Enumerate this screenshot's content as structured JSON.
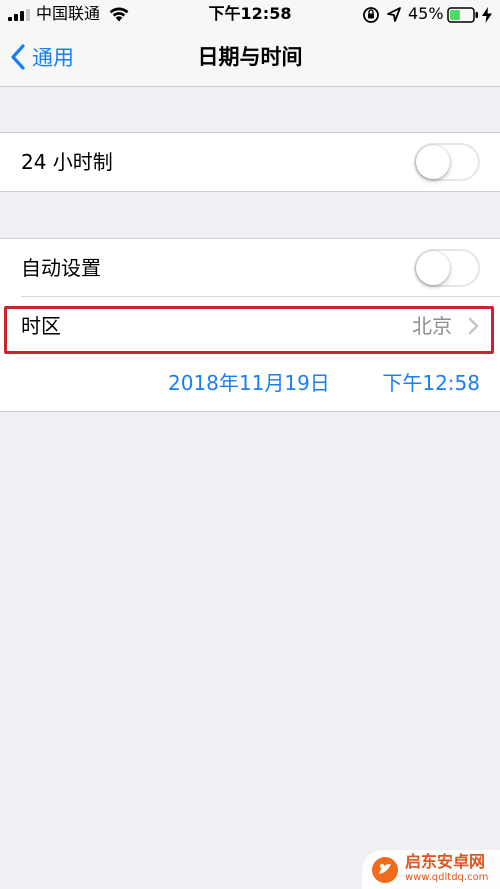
{
  "status_bar": {
    "carrier": "中国联通",
    "time": "下午12:58",
    "battery_percent": "45%",
    "battery_level": 0.45,
    "battery_color": "#4cd964"
  },
  "nav": {
    "back_label": "通用",
    "title": "日期与时间"
  },
  "settings": {
    "hour24": {
      "label": "24 小时制",
      "on": false
    },
    "auto_set": {
      "label": "自动设置",
      "on": false
    },
    "timezone": {
      "label": "时区",
      "value": "北京"
    },
    "date": "2018年11月19日",
    "time": "下午12:58"
  },
  "watermark": {
    "title": "启东安卓网",
    "url": "www.qdltdq.com"
  },
  "colors": {
    "accent": "#1a7ff5",
    "highlight_border": "#c8262c",
    "background": "#efeff4"
  }
}
